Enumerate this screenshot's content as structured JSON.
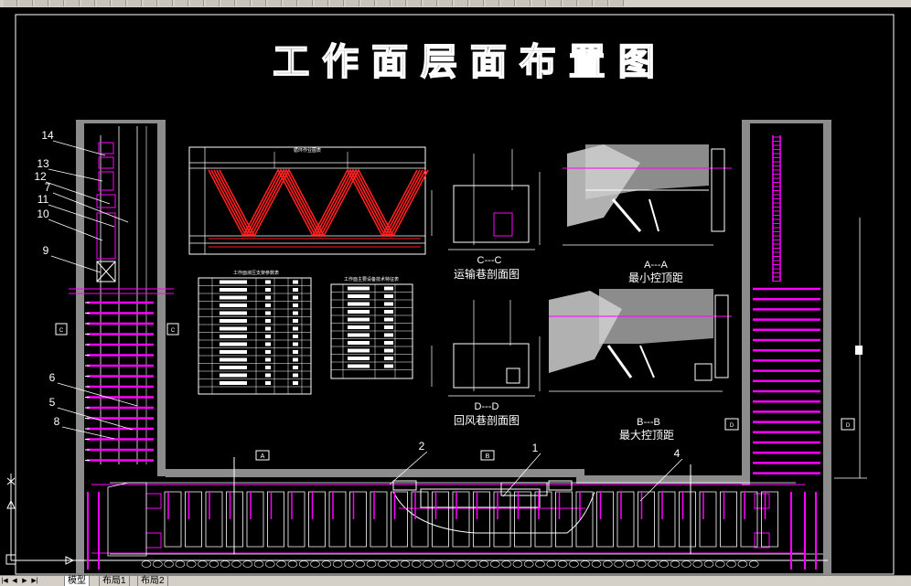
{
  "toolbar": {
    "button_count": 40
  },
  "drawing": {
    "title": "工 作 面 层 面 布 置 图",
    "section_labels": {
      "cc_caption": "C---C",
      "cc_name": "运输巷剖面图",
      "dd_caption": "D---D",
      "dd_name": "回风巷剖面图",
      "aa_caption": "A---A",
      "aa_name": "最小控顶距",
      "bb_caption": "B---B",
      "bb_name": "最大控顶距"
    },
    "callouts": [
      "14",
      "13",
      "12",
      "7",
      "11",
      "10",
      "9",
      "6",
      "5",
      "8",
      "2",
      "1",
      "4"
    ],
    "markers": {
      "a": "A",
      "b": "B",
      "c": "C",
      "d": "D"
    },
    "chart_title": "循环作业图表",
    "table1_title": "工作面液压支架参数表",
    "table2_title": "工作面主要设备技术特征表"
  },
  "colors": {
    "magenta": "#ff00ff",
    "red": "#ff2020",
    "gray": "#808080",
    "white": "#ffffff"
  },
  "tabs": {
    "items": [
      {
        "label": "模型"
      },
      {
        "label": "布局1"
      },
      {
        "label": "布局2"
      }
    ]
  }
}
